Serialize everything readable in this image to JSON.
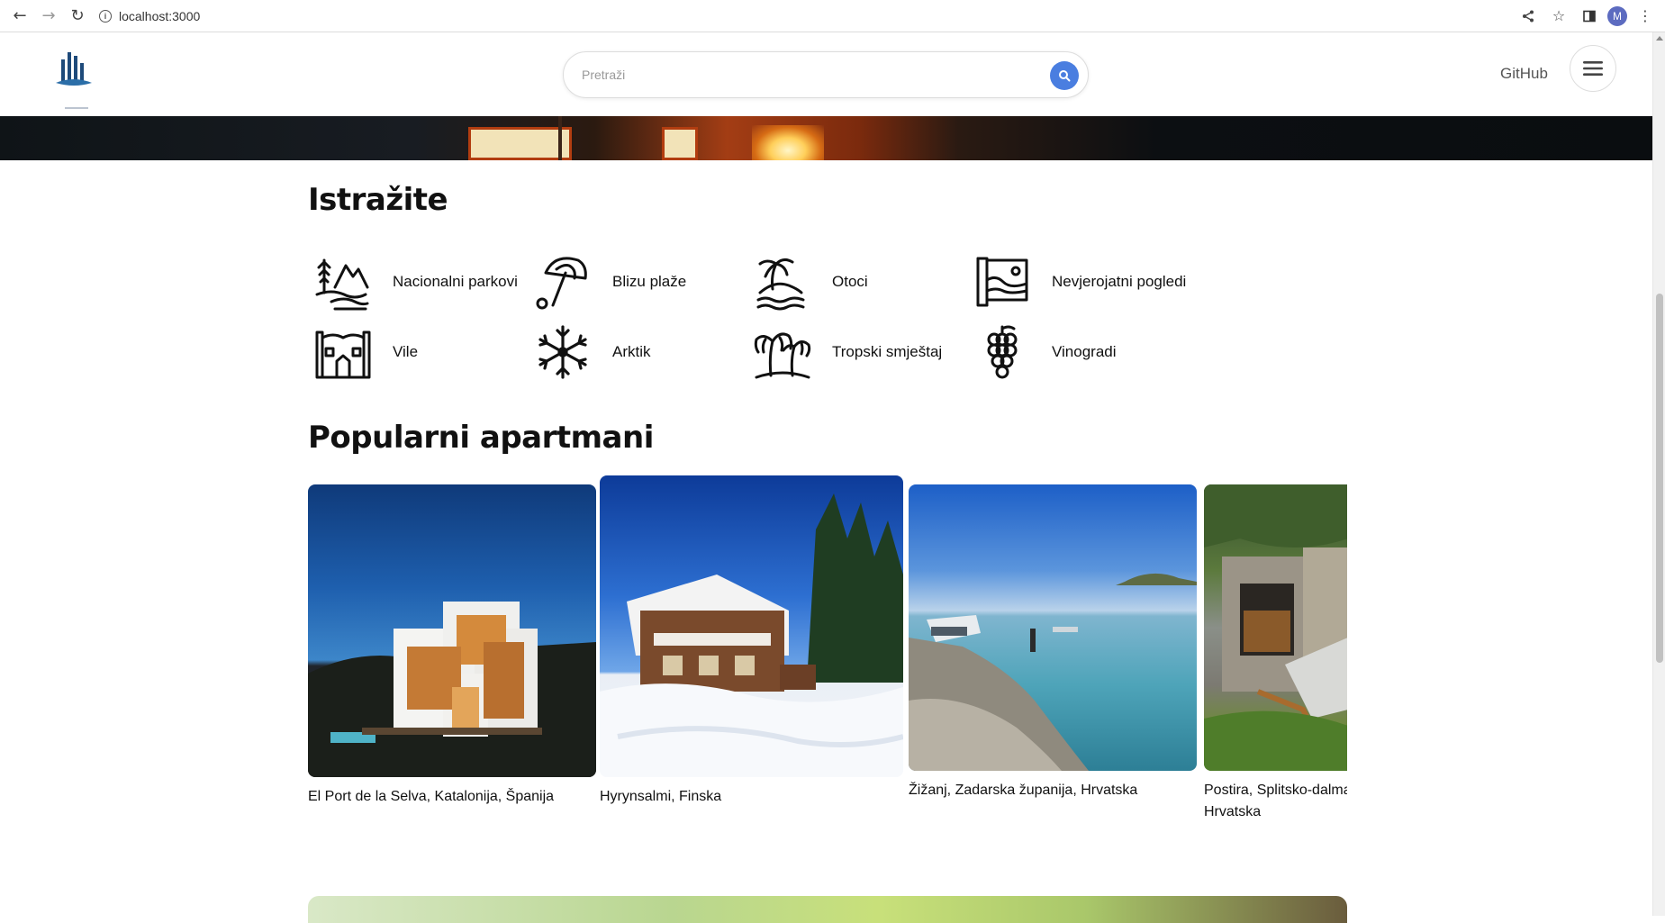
{
  "browser": {
    "url": "localhost:3000",
    "profile_initial": "M"
  },
  "header": {
    "search_placeholder": "Pretraži",
    "github_label": "GitHub"
  },
  "explore": {
    "title": "Istražite",
    "categories": [
      {
        "label": "Nacionalni parkovi",
        "icon": "national-park-icon"
      },
      {
        "label": "Blizu plaže",
        "icon": "beach-umbrella-icon"
      },
      {
        "label": "Otoci",
        "icon": "island-icon"
      },
      {
        "label": "Nevjerojatni pogledi",
        "icon": "view-icon"
      },
      {
        "label": "Vile",
        "icon": "villa-icon"
      },
      {
        "label": "Arktik",
        "icon": "snowflake-icon"
      },
      {
        "label": "Tropski smještaj",
        "icon": "tropical-icon"
      },
      {
        "label": "Vinogradi",
        "icon": "grapes-icon"
      }
    ]
  },
  "popular": {
    "title": "Popularni apartmani",
    "apartments": [
      {
        "location": "El Port de la Selva, Katalonija, Španija"
      },
      {
        "location": "Hyrynsalmi, Finska"
      },
      {
        "location": "Žižanj, Zadarska županija, Hrvatska"
      },
      {
        "location": "Postira, Splitsko-dalmatinska županija, Hrvatska"
      }
    ]
  },
  "colors": {
    "accent": "#4a7ee0"
  }
}
